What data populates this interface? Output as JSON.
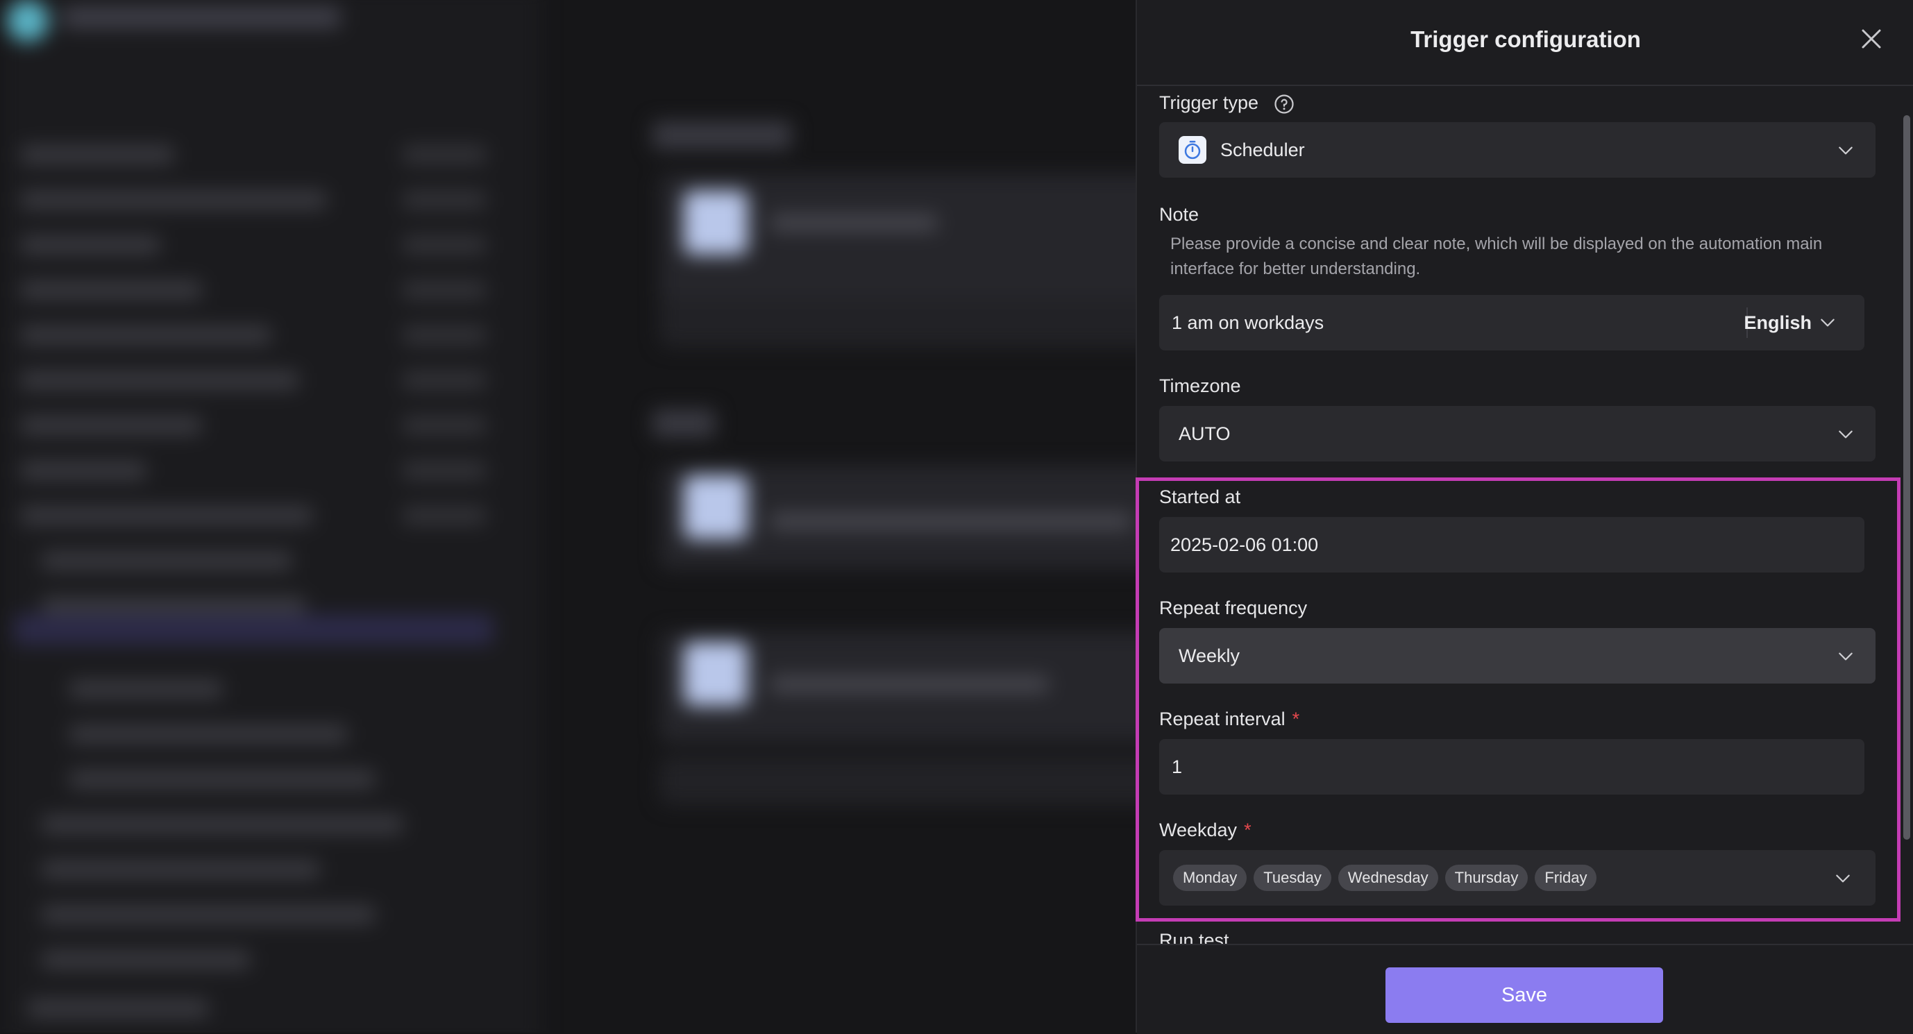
{
  "panel": {
    "title": "Trigger configuration",
    "trigger_type": {
      "label": "Trigger type",
      "value": "Scheduler"
    },
    "note": {
      "label": "Note",
      "description": "Please provide a concise and clear note, which will be displayed on the automation main interface for better understanding.",
      "value": "1 am on workdays",
      "language": "English"
    },
    "timezone": {
      "label": "Timezone",
      "value": "AUTO"
    },
    "started_at": {
      "label": "Started at",
      "value": "2025-02-06 01:00"
    },
    "repeat_frequency": {
      "label": "Repeat frequency",
      "value": "Weekly"
    },
    "repeat_interval": {
      "label": "Repeat interval",
      "required_mark": "*",
      "value": "1"
    },
    "weekday": {
      "label": "Weekday",
      "required_mark": "*",
      "selected": [
        "Monday",
        "Tuesday",
        "Wednesday",
        "Thursday",
        "Friday"
      ]
    },
    "run_test": {
      "label": "Run test"
    },
    "save_label": "Save"
  },
  "colors": {
    "accent": "#8b7cf0",
    "highlight_border": "#c43cb4",
    "required": "#e5484d"
  }
}
